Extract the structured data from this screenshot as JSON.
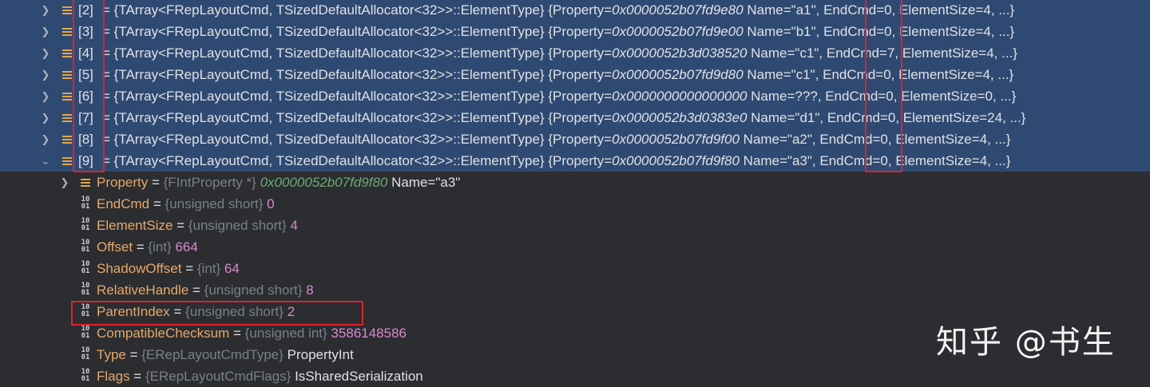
{
  "array_rows": [
    {
      "index": "[2]",
      "type_text": "{TArray<FRepLayoutCmd, TSizedDefaultAllocator<32>>::ElementType} {Property=",
      "ptr": "0x0000052b07fd9e80",
      "rest": " Name=\"a1\", EndCmd=0, ElementSize=4, ...}"
    },
    {
      "index": "[3]",
      "type_text": "{TArray<FRepLayoutCmd, TSizedDefaultAllocator<32>>::ElementType} {Property=",
      "ptr": "0x0000052b07fd9e00",
      "rest": " Name=\"b1\", EndCmd=0, ElementSize=4, ...}"
    },
    {
      "index": "[4]",
      "type_text": "{TArray<FRepLayoutCmd, TSizedDefaultAllocator<32>>::ElementType} {Property=",
      "ptr": "0x0000052b3d038520",
      "rest": " Name=\"c1\", EndCmd=7, ElementSize=4, ...}"
    },
    {
      "index": "[5]",
      "type_text": "{TArray<FRepLayoutCmd, TSizedDefaultAllocator<32>>::ElementType} {Property=",
      "ptr": "0x0000052b07fd9d80",
      "rest": " Name=\"c1\", EndCmd=0, ElementSize=4, ...}"
    },
    {
      "index": "[6]",
      "type_text": "{TArray<FRepLayoutCmd, TSizedDefaultAllocator<32>>::ElementType} {Property=",
      "ptr": "0x0000000000000000",
      "rest": " Name=???, EndCmd=0, ElementSize=0, ...}"
    },
    {
      "index": "[7]",
      "type_text": "{TArray<FRepLayoutCmd, TSizedDefaultAllocator<32>>::ElementType} {Property=",
      "ptr": "0x0000052b3d0383e0",
      "rest": " Name=\"d1\", EndCmd=0, ElementSize=24, ...}"
    },
    {
      "index": "[8]",
      "type_text": "{TArray<FRepLayoutCmd, TSizedDefaultAllocator<32>>::ElementType} {Property=",
      "ptr": "0x0000052b07fd9f00",
      "rest": " Name=\"a2\", EndCmd=0, ElementSize=4, ...}"
    },
    {
      "index": "[9]",
      "type_text": "{TArray<FRepLayoutCmd, TSizedDefaultAllocator<32>>::ElementType} {Property=",
      "ptr": "0x0000052b07fd9f80",
      "rest": " Name=\"a3\", EndCmd=0, ElementSize=4, ...}"
    }
  ],
  "expanded": {
    "property": {
      "name": "Property",
      "type": "{FIntProperty *}",
      "ptr": "0x0000052b07fd9f80",
      "rest": " Name=\"a3\""
    },
    "fields": [
      {
        "name": "EndCmd",
        "type": "{unsigned short}",
        "value": "0",
        "value_kind": "num"
      },
      {
        "name": "ElementSize",
        "type": "{unsigned short}",
        "value": "4",
        "value_kind": "num"
      },
      {
        "name": "Offset",
        "type": "{int}",
        "value": "664",
        "value_kind": "num"
      },
      {
        "name": "ShadowOffset",
        "type": "{int}",
        "value": "64",
        "value_kind": "num"
      },
      {
        "name": "RelativeHandle",
        "type": "{unsigned short}",
        "value": "8",
        "value_kind": "num"
      },
      {
        "name": "ParentIndex",
        "type": "{unsigned short}",
        "value": "2",
        "value_kind": "num"
      },
      {
        "name": "CompatibleChecksum",
        "type": "{unsigned int}",
        "value": "3586148586",
        "value_kind": "num"
      },
      {
        "name": "Type",
        "type": "{ERepLayoutCmdType}",
        "value": "PropertyInt",
        "value_kind": "text"
      },
      {
        "name": "Flags",
        "type": "{ERepLayoutCmdFlags}",
        "value": "IsSharedSerialization",
        "value_kind": "text"
      }
    ]
  },
  "equals": " = ",
  "watermark": "知乎 @书生",
  "colors": {
    "background": "#2b2d30",
    "selection": "#2f4a72",
    "highlight_box": "#e0202f"
  },
  "icons": {
    "collapsed": "chevron-right-icon",
    "expanded": "chevron-down-icon",
    "array": "array-icon",
    "binary": "binary-field-icon"
  }
}
